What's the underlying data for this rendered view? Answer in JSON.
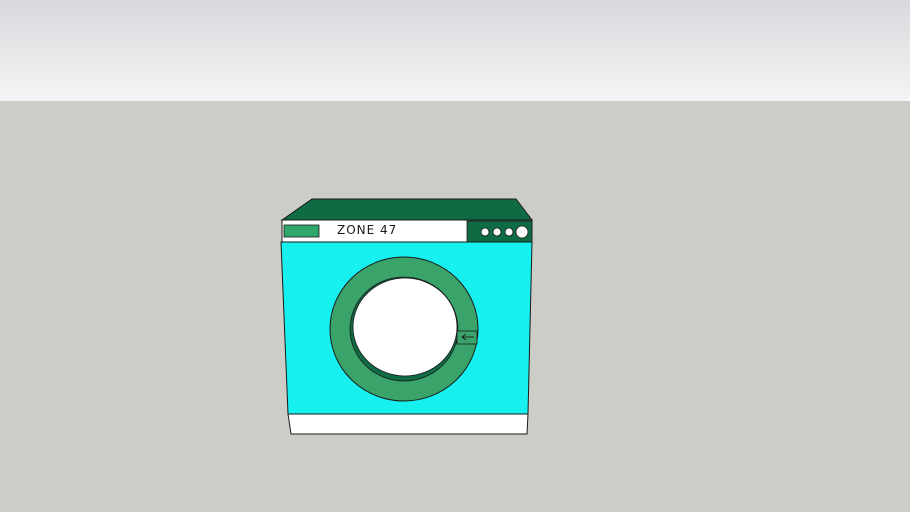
{
  "scene": {
    "sky_top_color": "#d7d9dc",
    "sky_bottom_color": "#f3f4f5",
    "ground_color": "#cdcdc8"
  },
  "washer": {
    "brand_label": "ZONE 47",
    "colors": {
      "body": "#16f0ee",
      "top": "#0e6b44",
      "accent_green": "#2fa66a",
      "door_ring": "#3aa36a",
      "door_glass": "#ffffff",
      "base": "#ffffff",
      "outline": "#1a1a1a"
    },
    "control_knobs": [
      "knob",
      "knob",
      "knob",
      "large-knob"
    ],
    "door_handle_icon": "arrow-left-icon"
  }
}
